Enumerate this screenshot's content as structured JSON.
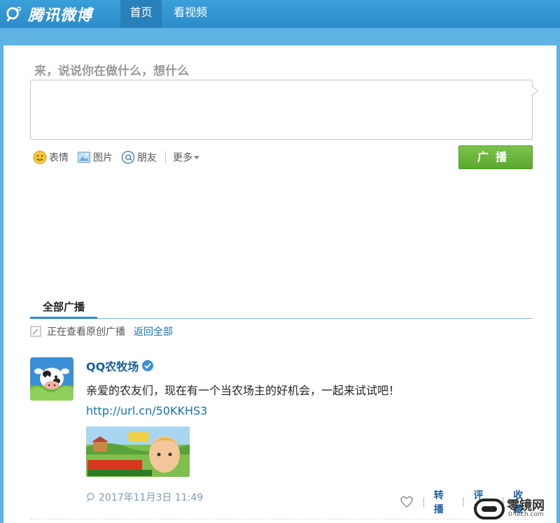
{
  "topnav": {
    "logo_text": "腾讯微博",
    "items": [
      {
        "label": "首页",
        "active": true
      },
      {
        "label": "看视频",
        "active": false
      }
    ]
  },
  "composer": {
    "prompt": "来，说说你在做什么，想什么",
    "value": "",
    "tools": [
      {
        "label": "表情",
        "icon": "smiley-icon"
      },
      {
        "label": "图片",
        "icon": "image-icon"
      },
      {
        "label": "朋友",
        "icon": "at-icon"
      }
    ],
    "more_label": "更多",
    "submit_label": "广播"
  },
  "feed_tabs": {
    "active_tab": "全部广播"
  },
  "filter": {
    "status": "正在查看原创广播",
    "back_label": "返回全部"
  },
  "post": {
    "author": "QQ农牧场",
    "verified": true,
    "text": "亲爱的农友们，现在有一个当农场主的好机会，一起来试试吧！",
    "link": "http://url.cn/50KKHS3",
    "timestamp": "2017年11月3日 11:49",
    "actions": [
      "转播",
      "评论",
      "收藏"
    ]
  },
  "watermark": {
    "text": "零镜网",
    "sub": "0-tech.com"
  },
  "colors": {
    "nav_bg": "#2d8ccb",
    "page_bg": "#5fb3e4",
    "submit_green": "#6ab53b",
    "link_blue": "#1a6fb0"
  }
}
